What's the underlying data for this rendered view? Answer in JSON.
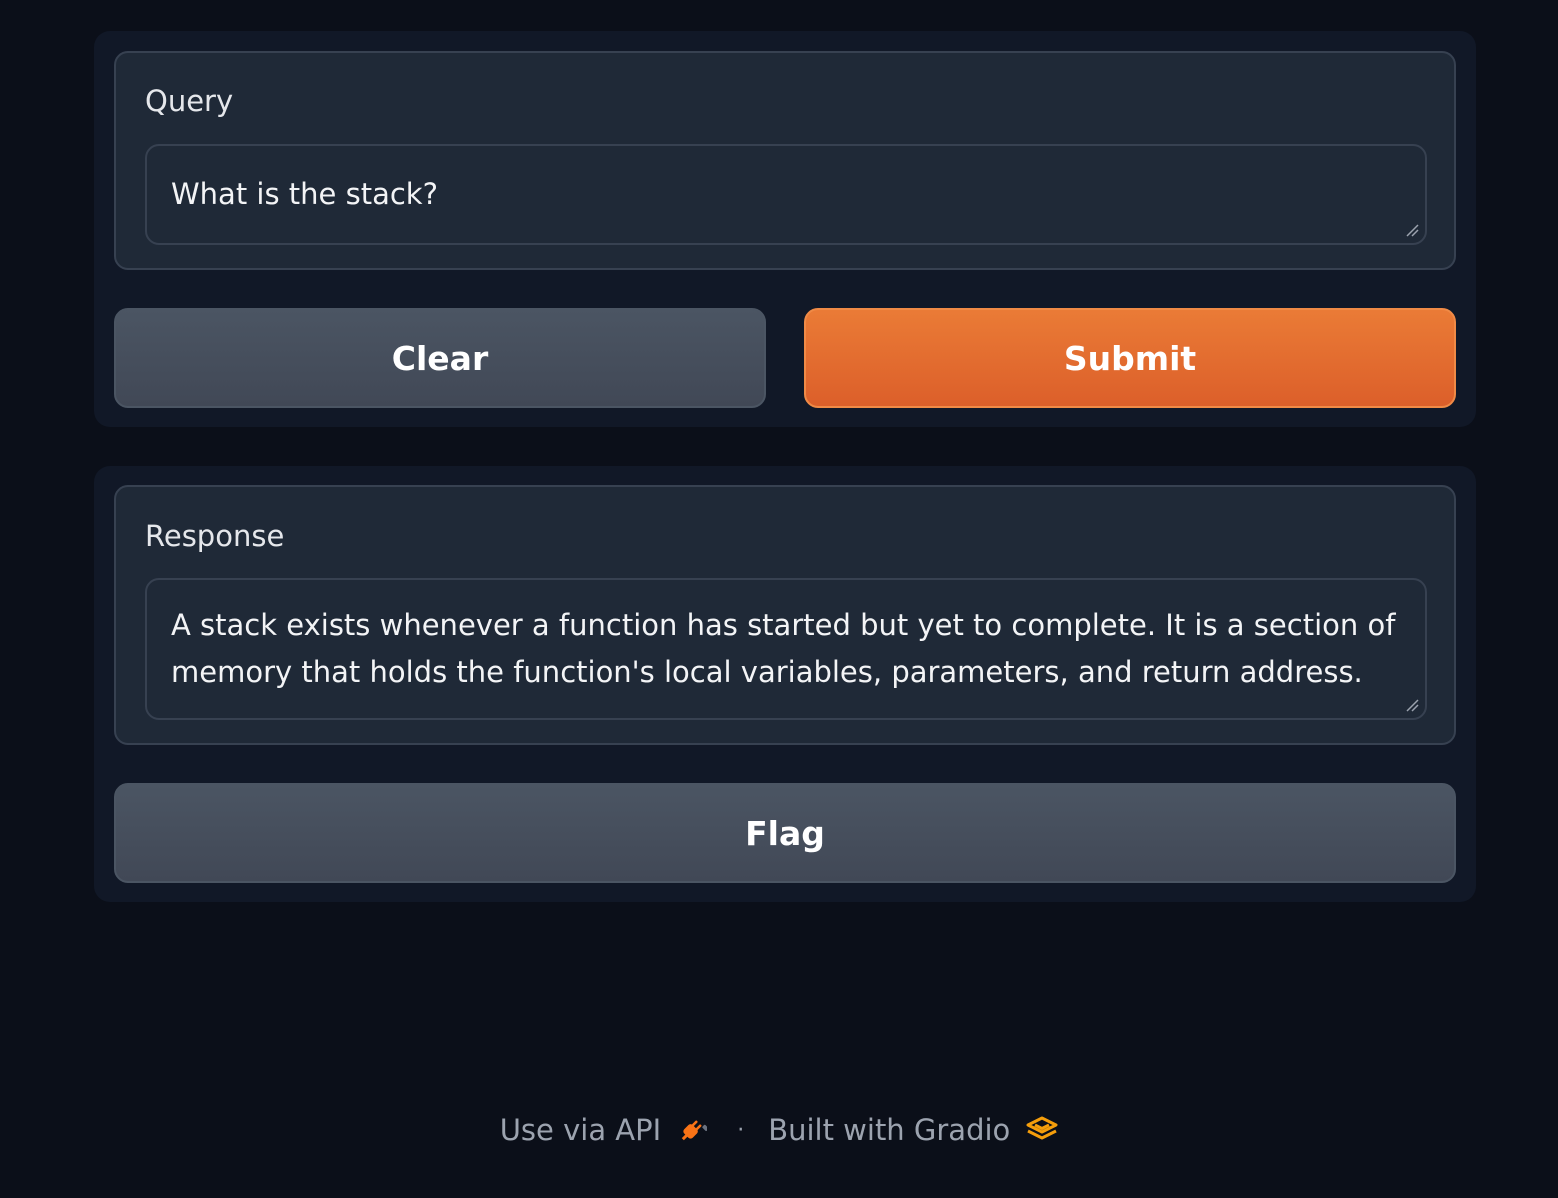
{
  "query": {
    "label": "Query",
    "value": "What is the stack?"
  },
  "actions": {
    "clear_label": "Clear",
    "submit_label": "Submit"
  },
  "response": {
    "label": "Response",
    "value": "A stack exists whenever a function has started but yet to complete. It is a section of memory that holds the function's local variables, parameters, and return address."
  },
  "flag": {
    "label": "Flag"
  },
  "footer": {
    "api_label": "Use via API",
    "separator": "·",
    "built_with_label": "Built with Gradio"
  },
  "colors": {
    "background": "#0b0f19",
    "panel": "#111827",
    "block": "#1f2937",
    "border": "#374151",
    "primary": "#e8702f",
    "secondary_button": "#4b5563"
  },
  "icons": {
    "api": "plug-icon",
    "gradio": "gradio-logo-icon",
    "resize": "resize-handle-icon"
  }
}
